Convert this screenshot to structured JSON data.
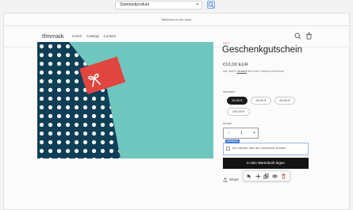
{
  "editor": {
    "variant_select": "Standardprodukt"
  },
  "store": {
    "announcement": "Welcome to our store",
    "logo": "tfmmaik",
    "nav": [
      "Home",
      "Catalog",
      "Contact"
    ]
  },
  "product": {
    "vendor": "GIFT",
    "title": "Geschenkgutschein",
    "price": "€10,00 EUR",
    "tax_note_prefix": "Inkl. MwSt.",
    "tax_note_link": "Versand",
    "tax_note_suffix": "wird beim Checkout berechnet",
    "denomination_label": "Nennwert",
    "denominations": [
      "10,00 €",
      "25,00 €",
      "50,00 €",
      "100,00 €"
    ],
    "selected_denomination": "10,00 €",
    "quantity_label": "Anzahl",
    "quantity": "1",
    "quantity_minus": "−",
    "quantity_plus": "+",
    "gift_tag": "Gift Button",
    "gift_checkbox_label": "Ich möchte dies als Geschenk senden",
    "add_to_cart": "In den Warenkorb legen",
    "share": "Share"
  },
  "colors": {
    "image_background": "#6fc6be",
    "envelope": "#0f3f57",
    "gift_card": "#e0463f",
    "selected_pill": "#1a1a1a",
    "add_to_cart": "#141414",
    "selection_outline": "#4a7fd6"
  },
  "icons": [
    "inspect-icon",
    "search-icon",
    "cart-icon",
    "share-icon",
    "select-block-icon",
    "move-block-icon",
    "duplicate-icon",
    "hide-icon",
    "delete-icon"
  ]
}
